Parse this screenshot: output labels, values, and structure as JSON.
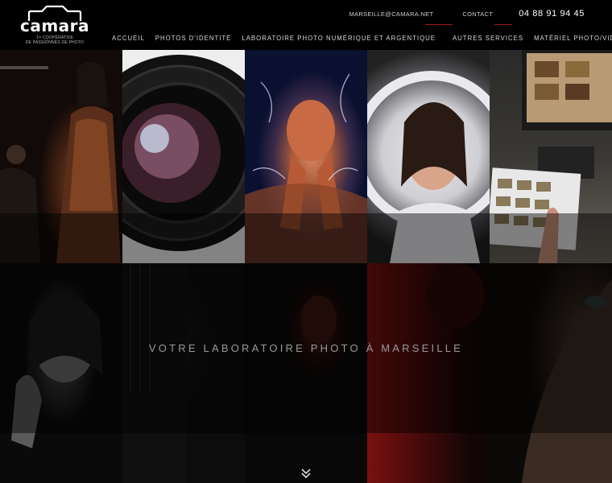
{
  "brand": {
    "name": "camara",
    "tagline_line1": "1ʳᵉ COOPÉRATIVE",
    "tagline_line2": "DE PASSIONNÉS DE PHOTO"
  },
  "topbar": {
    "email": "MARSEILLE@CAMARA.NET",
    "contact": "CONTACT",
    "phone": "04 88 91 94 45"
  },
  "nav": {
    "items": [
      {
        "label": "ACCUEIL"
      },
      {
        "label": "PHOTOS D'IDENTITÉ"
      },
      {
        "label": "LABORATOIRE PHOTO NUMÉRIQUE ET ARGENTIQUE"
      },
      {
        "label": "AUTRES SERVICES"
      },
      {
        "label": "MATÉRIEL PHOTO/VIDÉO"
      }
    ]
  },
  "hero": {
    "title": "VOTRE LABORATOIRE PHOTO À MARSEILLE"
  },
  "colors": {
    "accent": "#a01818",
    "background": "#000000"
  },
  "icons": {
    "logo": "camera-outline-icon",
    "scroll": "double-chevron-down-icon"
  }
}
